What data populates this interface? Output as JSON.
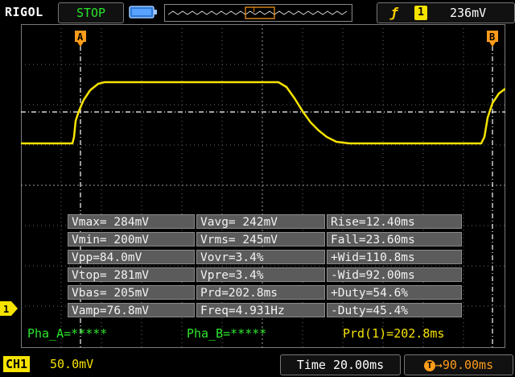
{
  "header": {
    "brand": "RIGOL",
    "run_state": "STOP",
    "trigger_channel": "1",
    "trigger_level": "236mV"
  },
  "channel_marker": "1",
  "measurements": [
    [
      "Vmax= 284mV",
      "Vavg= 242mV",
      "Rise=12.40ms"
    ],
    [
      "Vmin= 200mV",
      "Vrms= 245mV",
      "Fall=23.60ms"
    ],
    [
      "Vpp=84.0mV",
      "Vovr=3.4%",
      "+Wid=110.8ms"
    ],
    [
      "Vtop= 281mV",
      "Vpre=3.4%",
      "-Wid=92.00ms"
    ],
    [
      "Vbas= 205mV",
      "Prd=202.8ms",
      "+Duty=54.6%"
    ],
    [
      "Vamp=76.8mV",
      "Freq=4.931Hz",
      "-Duty=45.4%"
    ]
  ],
  "status": {
    "pha_a": "Pha_A=*****",
    "pha_b": "Pha_B=*****",
    "prd": "Prd(1)=202.8ms"
  },
  "footer": {
    "ch1_label": "CH1",
    "ch1_scale": "50.0mV",
    "timebase": "Time 20.00ms",
    "trigger_offset": "90.00ms"
  },
  "colors": {
    "trace": "#f6e300",
    "grid": "#6a6a6a",
    "status_green": "#2ee62e",
    "offset_orange": "#ff9c1a"
  }
}
